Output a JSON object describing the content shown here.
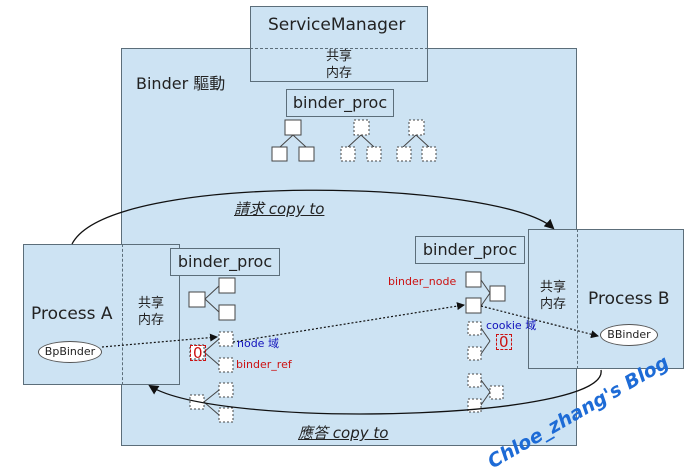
{
  "service_manager": {
    "title": "ServiceManager",
    "shared_mem": [
      "共享",
      "内存"
    ]
  },
  "binder_driver": {
    "title": "Binder  驅動"
  },
  "binder_proc_labels": [
    "binder_proc",
    "binder_proc",
    "binder_proc"
  ],
  "process_a": {
    "title": "Process A",
    "shared_mem": [
      "共享",
      "内存"
    ],
    "bp_binder": "BpBinder"
  },
  "process_b": {
    "title": "Process B",
    "shared_mem": [
      "共享",
      "内存"
    ],
    "b_binder": "BBinder"
  },
  "annotations": {
    "node_field": "node 域",
    "binder_ref": "binder_ref",
    "binder_node": "binder_node",
    "cookie_field": "cookie 域",
    "zero_a": "0",
    "zero_b": "0"
  },
  "arrows": {
    "request": "請求  copy to",
    "reply": "應答  copy to"
  },
  "watermark": "Chloe_zhang's Blog",
  "colors": {
    "fill": "#cde3f3",
    "red": "#cc1111",
    "blue": "#1111bb",
    "watermark": "#1d6bd6"
  }
}
